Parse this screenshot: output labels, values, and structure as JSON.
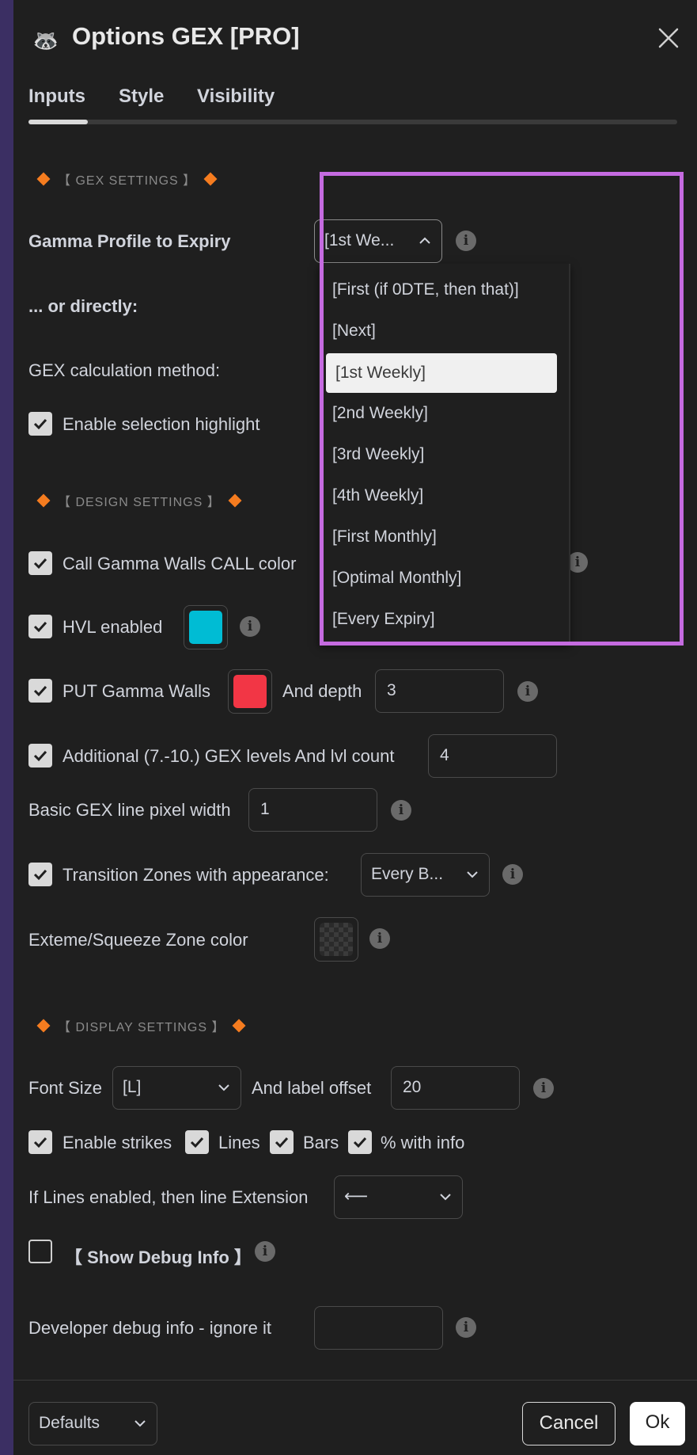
{
  "window": {
    "icon": "raccoon-icon",
    "title": "Options GEX [PRO]"
  },
  "tabs": [
    {
      "label": "Inputs",
      "active": true
    },
    {
      "label": "Style",
      "active": false
    },
    {
      "label": "Visibility",
      "active": false
    }
  ],
  "sections": {
    "gex": "【 GEX SETTINGS 】",
    "design": "【 DESIGN SETTINGS 】",
    "display": "【 DISPLAY SETTINGS 】"
  },
  "gex_settings": {
    "gamma_profile_label": "Gamma Profile to Expiry",
    "gamma_profile_value": "[1st We...",
    "directly_label": "... or directly:",
    "calc_method_label": "GEX calculation method:",
    "selection_highlight_label": "Enable selection highlight",
    "selection_highlight_checked": true
  },
  "expiry_dropdown": {
    "options": [
      "[First (if 0DTE, then that)]",
      "[Next]",
      "[1st Weekly]",
      "[2nd Weekly]",
      "[3rd Weekly]",
      "[4th Weekly]",
      "[First Monthly]",
      "[Optimal Monthly]",
      "[Every Expiry]"
    ],
    "selected": "[1st Weekly]"
  },
  "design_settings": {
    "call_walls_label": "Call Gamma Walls  CALL color",
    "call_walls_checked": true,
    "hvl_label": "HVL enabled",
    "hvl_checked": true,
    "hvl_color": "#00bcd4",
    "put_walls_label": "PUT Gamma Walls",
    "put_walls_checked": true,
    "put_color": "#f23645",
    "depth_label": "And depth",
    "depth_value": "3",
    "additional_label": "Additional (7.-10.) GEX levels  And lvl count",
    "additional_checked": true,
    "lvl_count_value": "4",
    "line_width_label": "Basic GEX line pixel width",
    "line_width_value": "1",
    "transition_label": "Transition Zones with appearance:",
    "transition_checked": true,
    "transition_value": "Every B...",
    "squeeze_label": "Exteme/Squeeze Zone color"
  },
  "display_settings": {
    "font_size_label": "Font Size",
    "font_size_value": "[L]",
    "label_offset_label": "And label offset",
    "label_offset_value": "20",
    "strikes_label": "Enable strikes",
    "strikes_checked": true,
    "lines_label": "Lines",
    "lines_checked": true,
    "bars_label": "Bars",
    "bars_checked": true,
    "pct_label": "% with info",
    "pct_checked": true,
    "line_ext_label": "If Lines enabled, then line Extension",
    "line_ext_value": "⟵",
    "debug_label": "【 Show Debug Info 】",
    "debug_checked": false,
    "dev_debug_label": "Developer debug info - ignore it",
    "dev_debug_value": ""
  },
  "footer": {
    "defaults_label": "Defaults",
    "cancel_label": "Cancel",
    "ok_label": "Ok"
  },
  "colors": {
    "accent_diamond": "#f57c1f",
    "highlight_border": "#c56be0",
    "dialog_bg": "#1f1f1f"
  }
}
